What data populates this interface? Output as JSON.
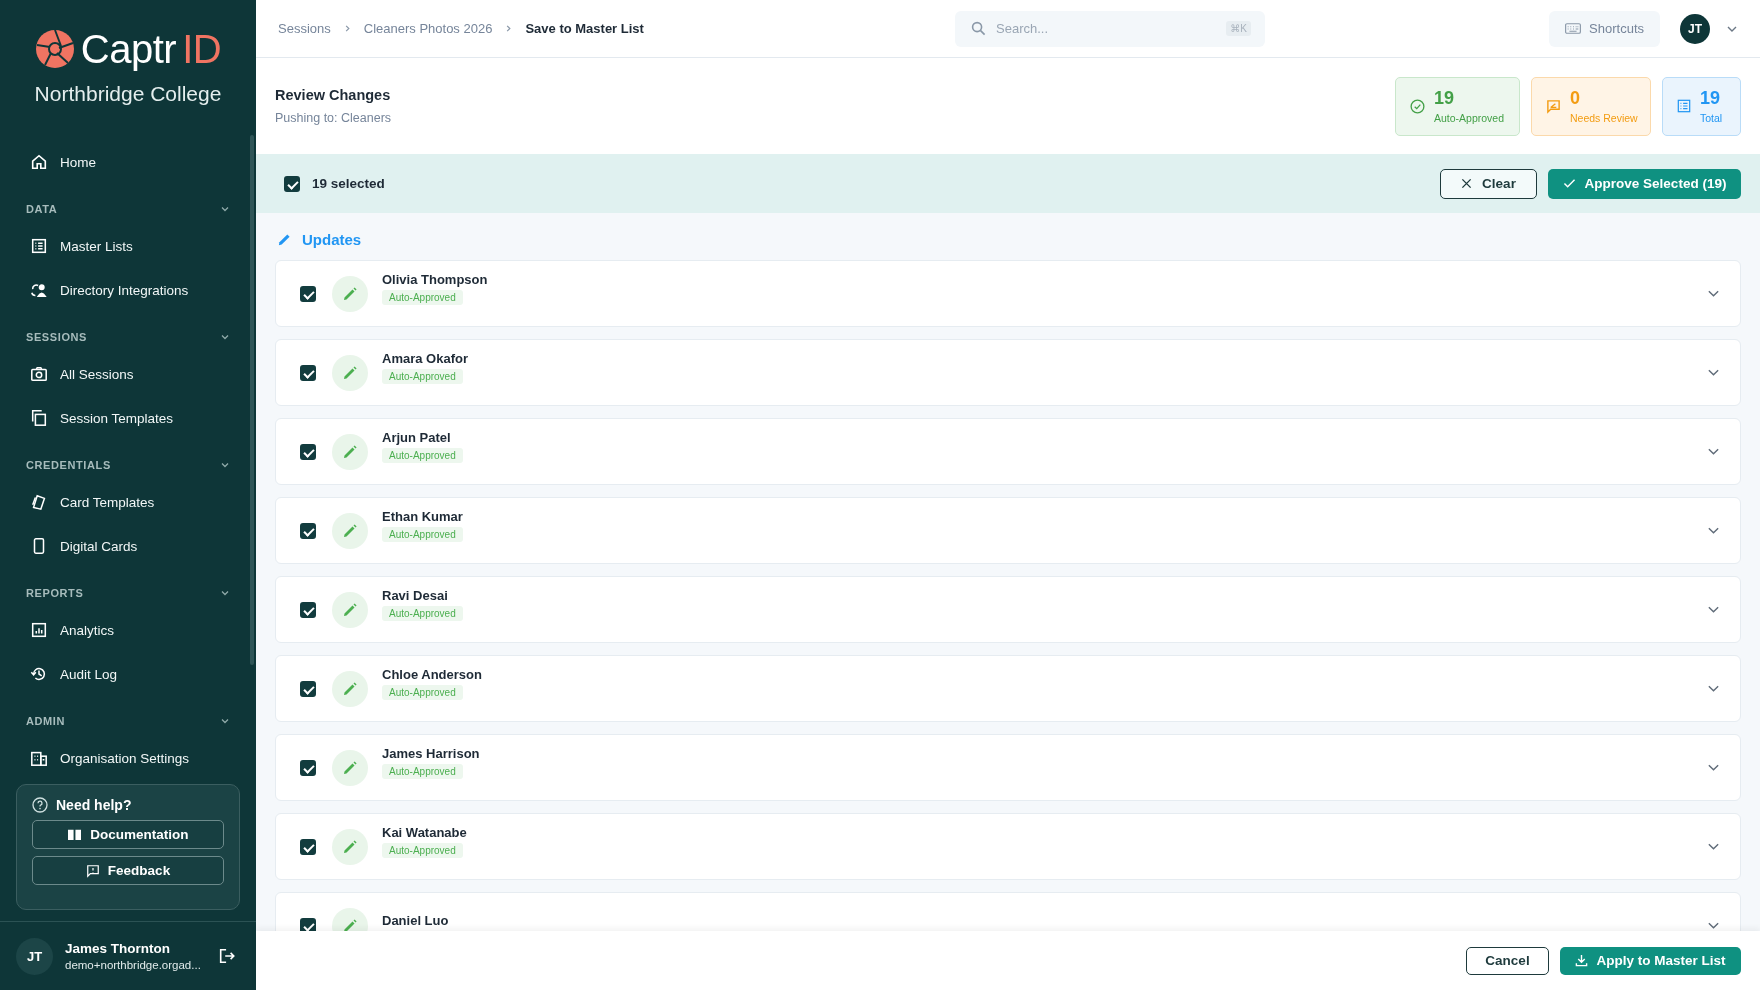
{
  "sidebar": {
    "logo": {
      "text": "Captr",
      "accent": "ID"
    },
    "organisation": "Northbridge College",
    "home": {
      "label": "Home",
      "selected": false
    },
    "sections": [
      {
        "title": "DATA",
        "expanded": true,
        "items": [
          {
            "label": "Master Lists",
            "selected": false
          },
          {
            "label": "Directory Integrations",
            "selected": false
          }
        ]
      },
      {
        "title": "SESSIONS",
        "expanded": true,
        "items": [
          {
            "label": "All Sessions",
            "selected": false
          },
          {
            "label": "Session Templates",
            "selected": false
          }
        ]
      },
      {
        "title": "CREDENTIALS",
        "expanded": true,
        "items": [
          {
            "label": "Card Templates",
            "selected": false
          },
          {
            "label": "Digital Cards",
            "selected": false
          }
        ]
      },
      {
        "title": "REPORTS",
        "expanded": true,
        "items": [
          {
            "label": "Analytics",
            "selected": false
          },
          {
            "label": "Audit Log",
            "selected": false
          }
        ]
      },
      {
        "title": "ADMIN",
        "expanded": true,
        "items": [
          {
            "label": "Organisation Settings",
            "selected": false
          }
        ]
      }
    ],
    "help": {
      "title": "Need help?",
      "buttons": [
        {
          "label": "Documentation"
        },
        {
          "label": "Feedback"
        }
      ]
    },
    "user": {
      "initials": "JT",
      "name": "James Thornton",
      "email": "demo+northbridge.orgad..."
    }
  },
  "header": {
    "breadcrumbs": [
      "Sessions",
      "Cleaners Photos 2026",
      "Save to Master List"
    ],
    "search": {
      "placeholder": "Search...",
      "shortcut": "⌘K"
    },
    "shortcuts": "Shortcuts",
    "avatar": "JT"
  },
  "review": {
    "title": "Review Changes",
    "subtitle": "Pushing to: Cleaners",
    "stats": [
      {
        "kind": "approved",
        "value": "19",
        "label": "Auto-Approved"
      },
      {
        "kind": "review",
        "value": "0",
        "label": "Needs Review"
      },
      {
        "kind": "total",
        "value": "19",
        "label": "Total"
      }
    ]
  },
  "selection": {
    "checked": true,
    "label": "19 selected",
    "clear": "Clear",
    "approve": "Approve Selected (19)"
  },
  "updates": {
    "title": "Updates",
    "rows": [
      {
        "name": "Olivia Thompson",
        "status": "Auto-Approved",
        "checked": true
      },
      {
        "name": "Amara Okafor",
        "status": "Auto-Approved",
        "checked": true
      },
      {
        "name": "Arjun Patel",
        "status": "Auto-Approved",
        "checked": true
      },
      {
        "name": "Ethan Kumar",
        "status": "Auto-Approved",
        "checked": true
      },
      {
        "name": "Ravi Desai",
        "status": "Auto-Approved",
        "checked": true
      },
      {
        "name": "Chloe Anderson",
        "status": "Auto-Approved",
        "checked": true
      },
      {
        "name": "James Harrison",
        "status": "Auto-Approved",
        "checked": true
      },
      {
        "name": "Kai Watanabe",
        "status": "Auto-Approved",
        "checked": true
      },
      {
        "name": "Daniel Luo",
        "checked": true
      }
    ]
  },
  "footer": {
    "cancel": "Cancel",
    "apply": "Apply to Master List"
  }
}
